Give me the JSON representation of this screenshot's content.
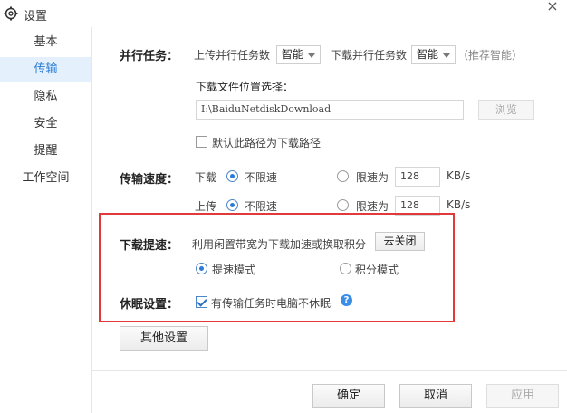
{
  "window": {
    "title": "设置",
    "close_label": "×"
  },
  "sidebar": {
    "items": [
      {
        "label": "基本"
      },
      {
        "label": "传输"
      },
      {
        "label": "隐私"
      },
      {
        "label": "安全"
      },
      {
        "label": "提醒"
      },
      {
        "label": "工作空间"
      }
    ],
    "active": "传输"
  },
  "parallel": {
    "label": "并行任务：",
    "upload_label": "上传并行任务数",
    "upload_value": "智能",
    "download_label": "下载并行任务数",
    "download_value": "智能",
    "hint": "（推荐智能）"
  },
  "download_location": {
    "label": "下载文件位置选择：",
    "path": "I:\\BaiduNetdiskDownload",
    "browse_label": "浏览",
    "default_checkbox_label": "默认此路径为下载路径",
    "default_checked": false
  },
  "speed": {
    "label": "传输速度：",
    "download": {
      "label": "下载",
      "unlimited_label": "不限速",
      "limit_label": "限速为",
      "limit_value": "128",
      "unit": "KB/s",
      "selected": "unlimited"
    },
    "upload": {
      "label": "上传",
      "unlimited_label": "不限速",
      "limit_label": "限速为",
      "limit_value": "128",
      "unit": "KB/s",
      "selected": "unlimited"
    }
  },
  "boost": {
    "label": "下载提速：",
    "description": "利用闲置带宽为下载加速或换取积分",
    "close_button": "去关闭",
    "mode_speed": "提速模式",
    "mode_points": "积分模式",
    "selected": "speed"
  },
  "sleep": {
    "label": "休眠设置：",
    "checkbox_label": "有传输任务时电脑不休眠",
    "checked": true,
    "help_icon": "?"
  },
  "other_settings_label": "其他设置",
  "footer": {
    "ok": "确定",
    "cancel": "取消",
    "apply": "应用"
  },
  "colors": {
    "accent": "#2c7cd6",
    "highlight_border": "#e03a3a",
    "active_bg": "#e4f0fb"
  }
}
